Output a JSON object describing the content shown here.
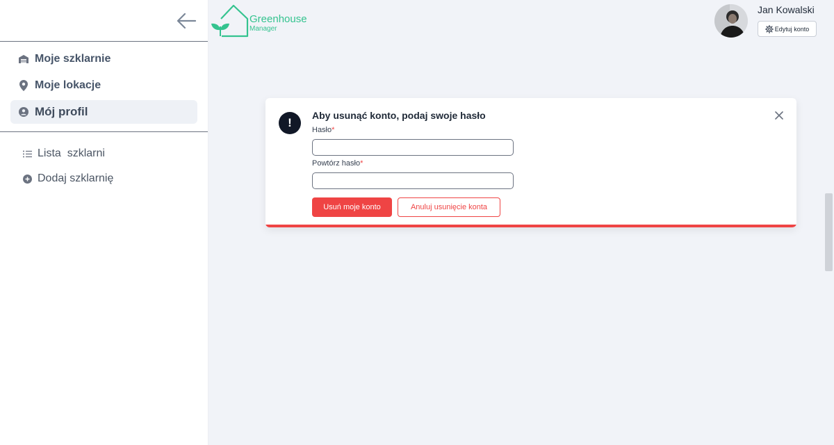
{
  "app": {
    "logo_title": "Greenhouse",
    "logo_subtitle": "Manager",
    "brand_color": "#34c38f"
  },
  "sidebar": {
    "back_icon": "arrow-left-icon",
    "main_items": [
      {
        "label": "Moje szklarnie",
        "icon": "warehouse-icon",
        "active": false
      },
      {
        "label": "Moje lokacje",
        "icon": "map-pin-icon",
        "active": false
      },
      {
        "label": "Mój profil",
        "icon": "user-circle-icon",
        "active": true
      }
    ],
    "sub_items": [
      {
        "label": "Lista  szklarni",
        "icon": "list-icon"
      },
      {
        "label": "Dodaj szklarnię",
        "icon": "plus-circle-icon"
      }
    ]
  },
  "header": {
    "user_name": "Jan Kowalski",
    "edit_label": "Edytuj konto"
  },
  "dialog": {
    "title": "Aby usunąć konto, podaj swoje hasło",
    "password_label": "Hasło",
    "password_value": "",
    "repeat_label": "Powtórz hasło",
    "repeat_value": "",
    "required_mark": "*",
    "delete_label": "Usuń moje konto",
    "cancel_label": "Anuluj usunięcie konta",
    "accent_color": "#ef4444"
  }
}
